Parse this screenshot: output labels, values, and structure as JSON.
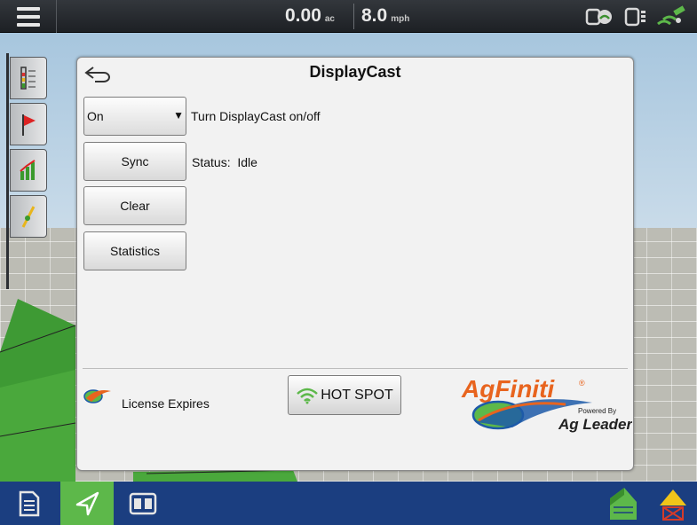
{
  "topbar": {
    "area_value": "0.00",
    "area_unit": "ac",
    "speed_value": "8.0",
    "speed_unit": "mph",
    "status_icons": [
      "connection-icon",
      "device-icon",
      "gps-satellite-icon"
    ]
  },
  "left_tabs": [
    "gauge-icon",
    "flag-icon",
    "chart-icon",
    "guidance-icon"
  ],
  "dialog": {
    "title": "DisplayCast",
    "mode_select": {
      "selected": "On",
      "description": "Turn DisplayCast on/off"
    },
    "sync_button": "Sync",
    "status_text": "Status:  Idle",
    "clear_button": "Clear",
    "statistics_button": "Statistics",
    "license_text": "License Expires",
    "hotspot_button": "HOT SPOT",
    "logo": {
      "brand": "AgFiniti",
      "powered_by": "Powered By",
      "maker": "Ag Leader"
    }
  },
  "bottombar": {
    "buttons": [
      "document-icon",
      "navigate-icon",
      "split-screen-icon",
      "field-icon",
      "warning-icon"
    ]
  },
  "colors": {
    "accent_green": "#5db84a",
    "bottom_bar": "#1b3e80",
    "logo_orange": "#e8641e",
    "logo_blue": "#1d5aa8"
  }
}
